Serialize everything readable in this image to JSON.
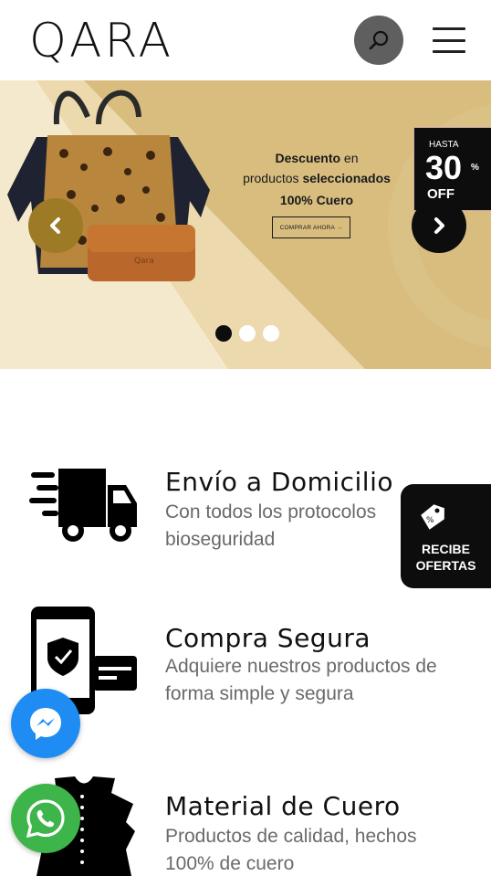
{
  "header": {
    "logo": "QARA",
    "search_icon": "search-icon",
    "menu_icon": "hamburger-menu-icon"
  },
  "banner": {
    "promo_line1_bold": "Descuento",
    "promo_line1_rest": " en",
    "promo_line2_rest": "productos ",
    "promo_line2_bold": "seleccionados",
    "promo_line3": "100% Cuero",
    "shop_button": "COMPRAR AHORA →",
    "discount": {
      "hasta": "HASTA",
      "value": "30",
      "percent": "%",
      "off": "OFF"
    },
    "prev_icon": "chevron-left-icon",
    "next_icon": "chevron-right-icon",
    "slides": 3,
    "active_slide": 1,
    "colors": {
      "banner_bg": "#d8bd7f",
      "prev_arrow": "#9c7a26",
      "next_arrow": "#0d0d0d"
    }
  },
  "features": [
    {
      "title": "Envío a Domicilio",
      "desc": "Con todos los protocolos bioseguridad",
      "icon": "delivery-truck-icon"
    },
    {
      "title": "Compra Segura",
      "desc": "Adquiere nuestros productos de forma simple y segura",
      "icon": "secure-payment-phone-icon"
    },
    {
      "title": "Material de Cuero",
      "desc": "Productos de calidad, hechos 100% de cuero",
      "icon": "leather-hide-icon"
    }
  ],
  "floating": {
    "offers_label_1": "RECIBE",
    "offers_label_2": "OFERTAS",
    "offers_icon": "price-tag-icon",
    "messenger_icon": "messenger-icon",
    "whatsapp_icon": "whatsapp-icon",
    "colors": {
      "messenger": "#1f8cf3",
      "whatsapp": "#3db54a"
    }
  }
}
